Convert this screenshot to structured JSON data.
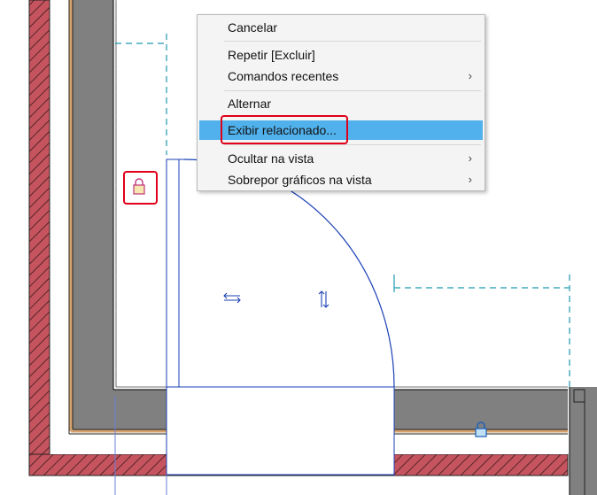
{
  "context_menu": {
    "items": [
      {
        "label": "Cancelar",
        "has_submenu": false
      },
      {
        "label": "Repetir [Excluir]",
        "has_submenu": false
      },
      {
        "label": "Comandos recentes",
        "has_submenu": true
      },
      {
        "label": "Alternar",
        "has_submenu": false
      },
      {
        "label": "Exibir relacionado...",
        "has_submenu": false,
        "highlighted": true
      },
      {
        "label": "Ocultar na vista",
        "has_submenu": true
      },
      {
        "label": "Sobrepor gráficos na vista",
        "has_submenu": true
      }
    ],
    "submenu_glyph": "›",
    "highlight_color": "#51b1ec",
    "callout_color": "#e0001a"
  },
  "drawing": {
    "wall_hatch_color": "#c5545e",
    "wall_core_color": "#808080",
    "finish_color": "#d6a36e",
    "selection_color": "#1a3fb5",
    "dimension_color": "#1e9ab0",
    "icons": [
      "lock-icon",
      "lock-icon",
      "flip-horizontal-icon",
      "flip-vertical-icon"
    ]
  }
}
